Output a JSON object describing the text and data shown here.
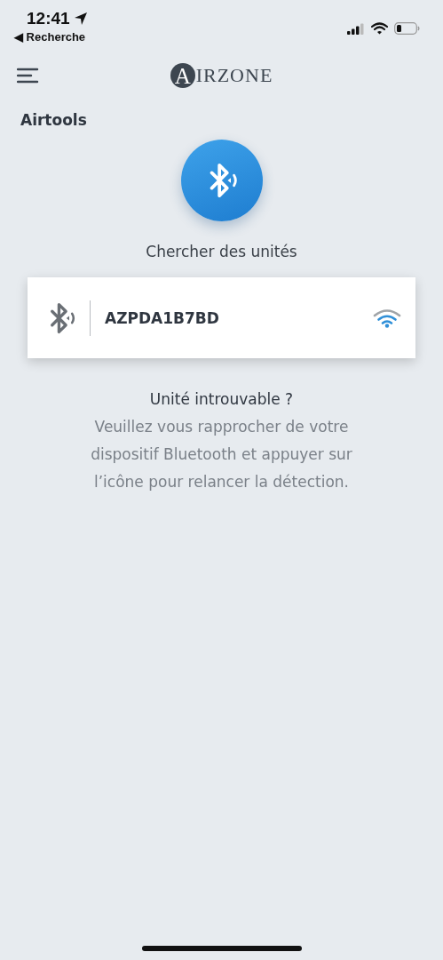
{
  "status_bar": {
    "time": "12:41",
    "back_link": "◀ Recherche"
  },
  "header": {
    "logo_initial": "A",
    "logo_rest": "IRZONE"
  },
  "section_title": "Airtools",
  "scan": {
    "label": "Chercher des unités"
  },
  "devices": [
    {
      "name": "AZPDA1B7BD"
    }
  ],
  "help": {
    "title": "Unité introuvable ?",
    "text": "Veuillez vous rapprocher de votre dispositif Bluetooth et appuyer sur l’icône pour relancer la détection."
  }
}
